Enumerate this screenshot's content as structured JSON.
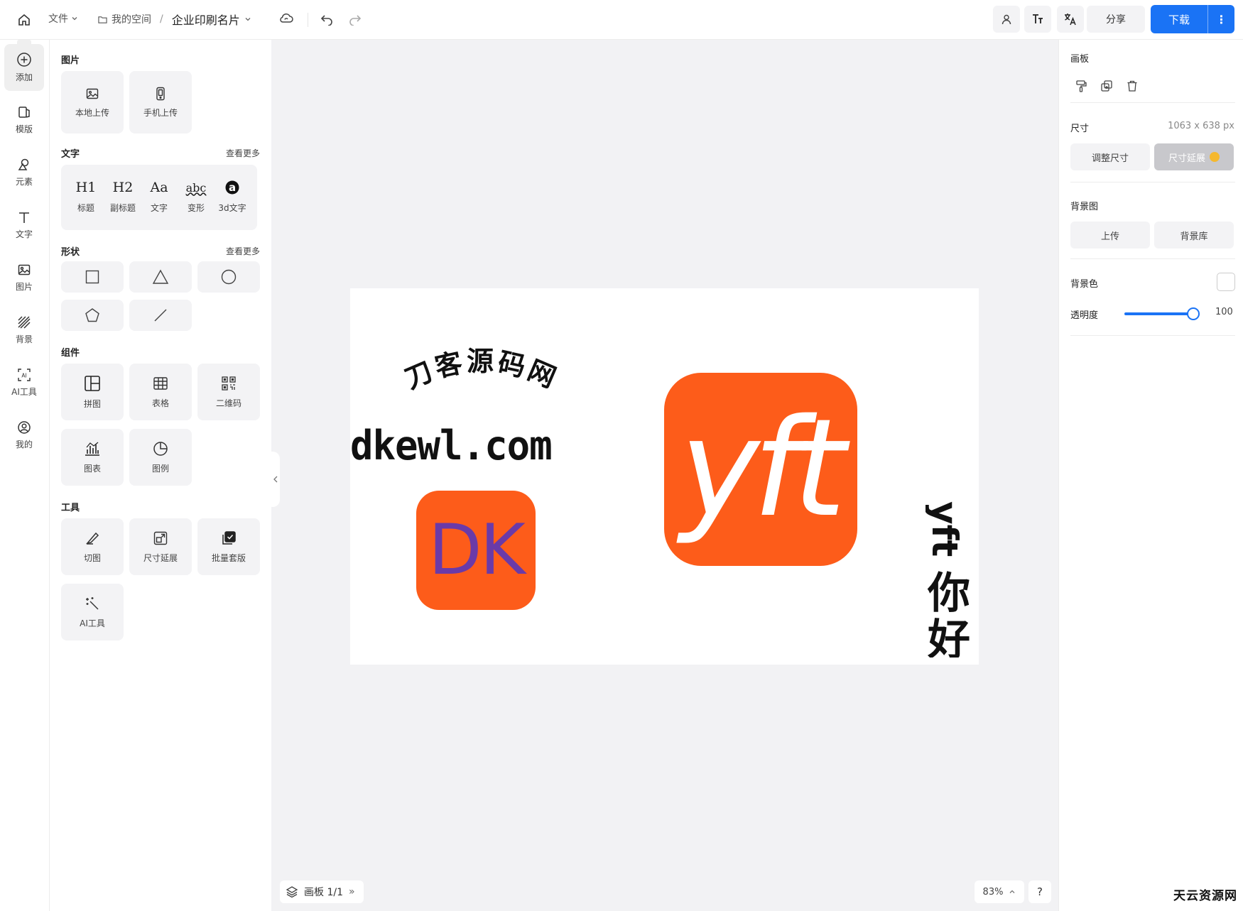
{
  "topbar": {
    "file_label": "文件",
    "space_label": "我的空间",
    "separator": "/",
    "doc_title": "企业印刷名片",
    "share_label": "分享",
    "download_label": "下载",
    "download_more": "⋮"
  },
  "leftnav": {
    "items": [
      {
        "label": "添加",
        "icon": "add-circle-icon"
      },
      {
        "label": "模版",
        "icon": "template-icon"
      },
      {
        "label": "元素",
        "icon": "elements-icon"
      },
      {
        "label": "文字",
        "icon": "text-icon"
      },
      {
        "label": "图片",
        "icon": "image-icon"
      },
      {
        "label": "背景",
        "icon": "background-icon"
      },
      {
        "label": "AI工具",
        "icon": "ai-icon"
      },
      {
        "label": "我的",
        "icon": "user-circle-icon"
      }
    ]
  },
  "panel": {
    "images": {
      "title": "图片",
      "local_upload": "本地上传",
      "phone_upload": "手机上传"
    },
    "text": {
      "title": "文字",
      "more": "查看更多",
      "items": [
        {
          "glyph": "H1",
          "label": "标题"
        },
        {
          "glyph": "H2",
          "label": "副标题"
        },
        {
          "glyph": "Aa",
          "label": "文字"
        },
        {
          "glyph": "abc",
          "label": "变形"
        },
        {
          "glyph": "a",
          "label": "3d文字"
        }
      ]
    },
    "shapes": {
      "title": "形状",
      "more": "查看更多"
    },
    "components": {
      "title": "组件",
      "items": [
        "拼图",
        "表格",
        "二维码",
        "图表",
        "图例"
      ]
    },
    "tools": {
      "title": "工具",
      "items": [
        "切图",
        "尺寸延展",
        "批量套版",
        "AI工具"
      ]
    }
  },
  "canvas": {
    "arc_text": "刀客源码网",
    "url_text": "dkewl.com",
    "dk_logo_text": "DK",
    "yft_logo_text": "yft",
    "vertical_latin": "yft",
    "vertical_cjk": [
      "你",
      "好"
    ],
    "brand_orange": "#fd5c1a",
    "dk_purple": "#6a3aa8",
    "pager_label": "画板 1/1",
    "zoom_label": "83%",
    "help_label": "?"
  },
  "props": {
    "board_title": "画板",
    "size_label": "尺寸",
    "size_value": "1063 x 638 px",
    "resize_button": "调整尺寸",
    "extend_button": "尺寸延展",
    "bg_image_label": "背景图",
    "upload_button": "上传",
    "bg_library_button": "背景库",
    "bg_color_label": "背景色",
    "opacity_label": "透明度",
    "opacity_value": "100",
    "accent_color": "#1a73f5"
  },
  "watermark": "天云资源网"
}
